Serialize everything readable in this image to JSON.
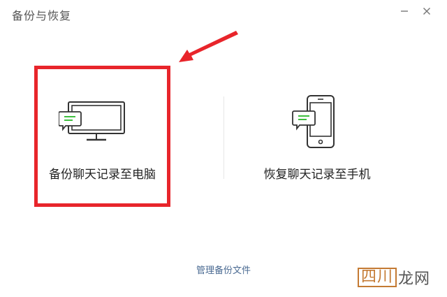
{
  "window": {
    "title": "备份与恢复"
  },
  "controls": {
    "minimize_icon": "minimize-icon",
    "close_icon": "close-icon"
  },
  "options": [
    {
      "label": "备份聊天记录至电脑",
      "icon": "computer-chat-icon"
    },
    {
      "label": "恢复聊天记录至手机",
      "icon": "phone-chat-icon"
    }
  ],
  "footer": {
    "manage_link": "管理备份文件"
  },
  "watermark": {
    "boxed": "四川",
    "text": "龙网"
  },
  "colors": {
    "highlight": "#e8252b",
    "link": "#4a6a92",
    "accent_green": "#3fbf3f"
  }
}
